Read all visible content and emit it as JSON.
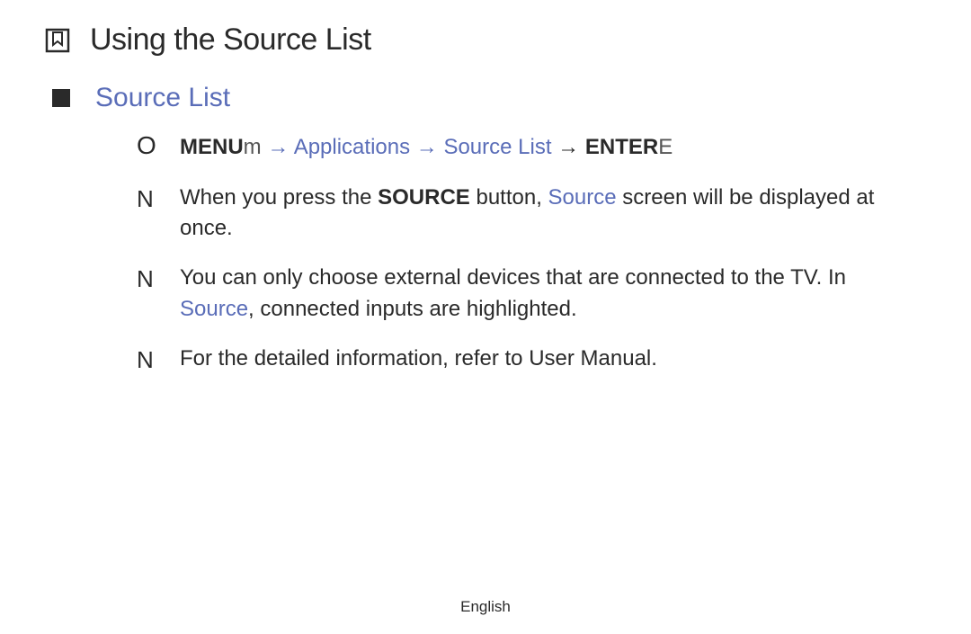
{
  "page": {
    "title": "Using the Source List"
  },
  "section": {
    "heading": "Source List"
  },
  "nav": {
    "marker": "O",
    "menu": "MENU",
    "menu_suffix": "m",
    "arrow1": "  → ",
    "applications": "Applications",
    "arrow2": " → ",
    "source_list": "Source List",
    "arrow3": " → ",
    "enter": "ENTER",
    "enter_suffix": "E"
  },
  "notes": {
    "marker": "N",
    "item1_a": "When you press the ",
    "item1_source_btn": "SOURCE",
    "item1_b": " button, ",
    "item1_source_word": "Source",
    "item1_c": " screen will be displayed at once.",
    "item2_a": "You can only choose external devices that are connected to the TV. In ",
    "item2_source_word": "Source",
    "item2_b": ", connected inputs are highlighted.",
    "item3": "For the detailed information, refer to User Manual."
  },
  "footer": {
    "language": "English"
  }
}
